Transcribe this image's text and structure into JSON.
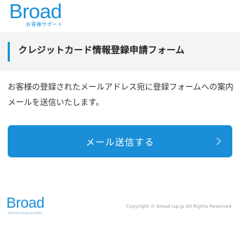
{
  "header": {
    "logo": "Broad",
    "logo_sub": "お客様サポート"
  },
  "main": {
    "title": "クレジットカード情報登録申請フォーム",
    "message": "お客様の登録されたメールアドレス宛に登録フォームへの案内メールを送信いたします。",
    "send_button_label": "メール送信する"
  },
  "footer": {
    "logo": "Broad",
    "logo_sub": "Internet service provider",
    "copyright": "Copyright © broad-isp.jp All Rights Reserved."
  },
  "icons": {
    "send_button": "chevron-right-icon"
  },
  "colors": {
    "brand": "#1a8fd8",
    "title_bar": "#f4f4f4",
    "text": "#333333",
    "copyright": "#999999"
  }
}
